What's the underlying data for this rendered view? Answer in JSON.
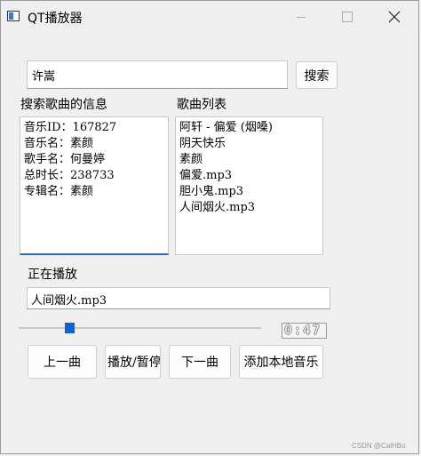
{
  "window": {
    "title": "QT播放器"
  },
  "search": {
    "value": "许嵩",
    "button_label": "搜索"
  },
  "info": {
    "label": "搜索歌曲的信息",
    "lines": [
      "音乐ID：167827",
      "音乐名：素颜",
      "歌手名：何曼婷",
      "总时长：238733",
      "专辑名：素颜"
    ]
  },
  "playlist": {
    "label": "歌曲列表",
    "items": [
      "阿轩 - 偏爱 (烟嗓)",
      "阴天快乐",
      "素颜",
      "偏爱.mp3",
      "胆小鬼.mp3",
      "人间烟火.mp3"
    ]
  },
  "now_playing": {
    "label": "正在播放",
    "value": "人间烟火.mp3"
  },
  "progress": {
    "fraction": 0.2,
    "time_display": "0:47"
  },
  "controls": {
    "prev": "上一曲",
    "play_pause": "播放/暂停",
    "next": "下一曲",
    "add_local": "添加本地音乐"
  },
  "watermark": "CSDN @CalHBo",
  "colors": {
    "accent": "#0a64d8",
    "focus_underline": "#2d6cc8"
  }
}
